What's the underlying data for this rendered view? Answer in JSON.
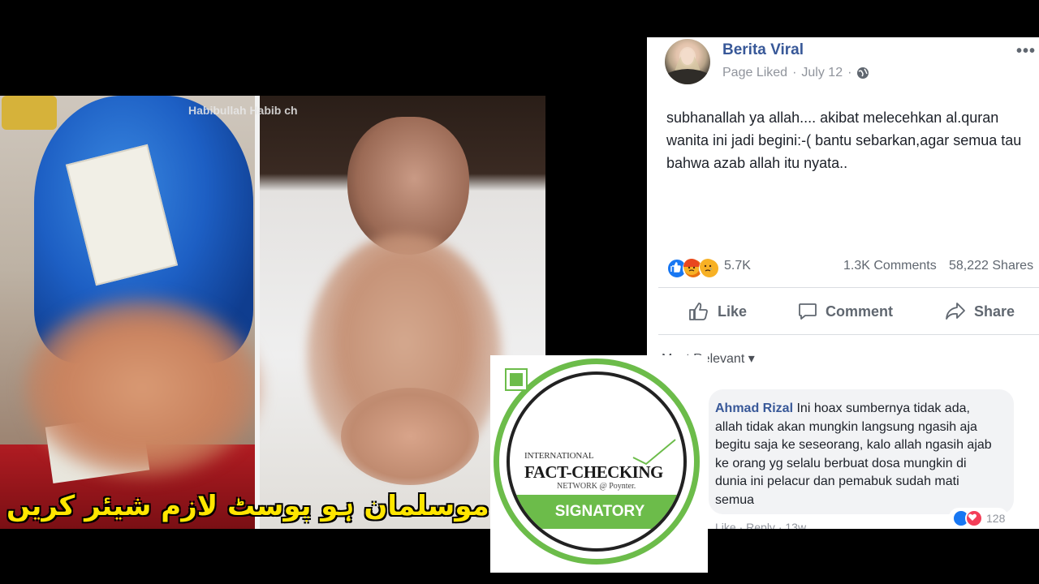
{
  "photo": {
    "watermark": "Habibullah Habib ch",
    "caption": "تم موسلمان ہو پوسٹ لازم شیئر کریں"
  },
  "post": {
    "page_name": "Berita Viral",
    "status": "Page Liked",
    "date": "July 12",
    "separator": "·",
    "more": "•••",
    "text": "subhanallah ya allah.... akibat melecehkan al.quran wanita ini jadi begini:-( bantu sebarkan,agar semua tau bahwa azab allah itu nyata..",
    "reaction_count": "5.7K",
    "comment_count": "1.3K Comments",
    "share_count": "58,222 Shares",
    "actions": {
      "like": "Like",
      "comment": "Comment",
      "share": "Share"
    },
    "sort_label": "Most Relevant ▾",
    "reaction_icons": [
      "like-icon",
      "angry-icon",
      "sad-icon"
    ]
  },
  "comment": {
    "author": "Ahmad Rizal",
    "text": "Ini hoax sumbernya tidak ada, allah tidak akan mungkin langsung ngasih aja begitu saja ke seseorang, kalo allah ngasih ajab ke orang yg selalu berbuat dosa mungkin di dunia ini pelacur dan pemabuk sudah mati semua",
    "like": "Like",
    "reply": "Reply",
    "time": "13w",
    "reaction_count": "128"
  },
  "badge": {
    "line1": "INTERNATIONAL",
    "line2": "FACT-CHECKING",
    "line3": "NETWORK @ Poynter.",
    "signatory": "SIGNATORY"
  },
  "colors": {
    "fb_blue": "#385898",
    "ifcn_green": "#6cbc4a",
    "caption_yellow": "#ffe600"
  }
}
